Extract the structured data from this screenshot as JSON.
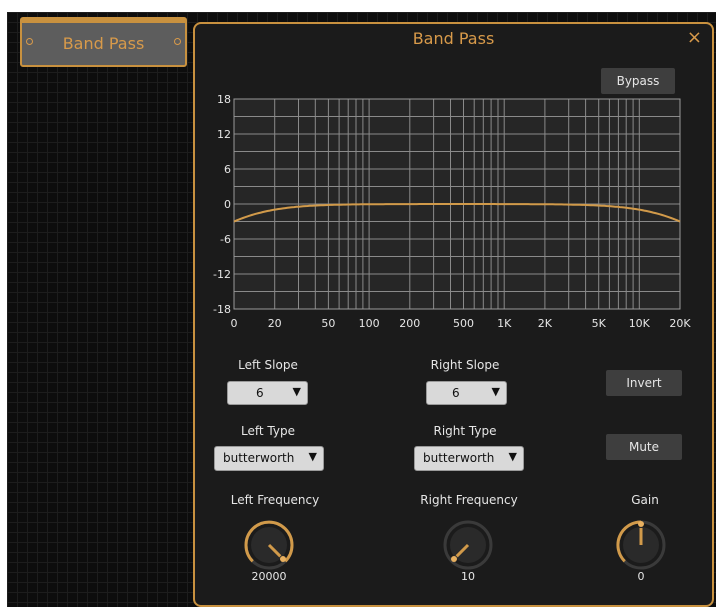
{
  "node": {
    "title": "Band Pass"
  },
  "dialog": {
    "title": "Band Pass",
    "close_icon": "×",
    "bypass_label": "Bypass",
    "invert_label": "Invert",
    "mute_label": "Mute"
  },
  "graph": {
    "y_ticks": [
      "18",
      "12",
      "6",
      "0",
      "-6",
      "-12",
      "-18"
    ],
    "x_ticks": [
      "0",
      "20",
      "50",
      "100",
      "200",
      "500",
      "1K",
      "2K",
      "5K",
      "10K",
      "20K"
    ],
    "curve_color": "#d19a4a"
  },
  "left_slope": {
    "label": "Left Slope",
    "value": "6"
  },
  "right_slope": {
    "label": "Right Slope",
    "value": "6"
  },
  "left_type": {
    "label": "Left Type",
    "value": "butterworth"
  },
  "right_type": {
    "label": "Right Type",
    "value": "butterworth"
  },
  "left_frequency": {
    "label": "Left Frequency",
    "value": "20000"
  },
  "right_frequency": {
    "label": "Right Frequency",
    "value": "10"
  },
  "gain": {
    "label": "Gain",
    "value": "0"
  }
}
